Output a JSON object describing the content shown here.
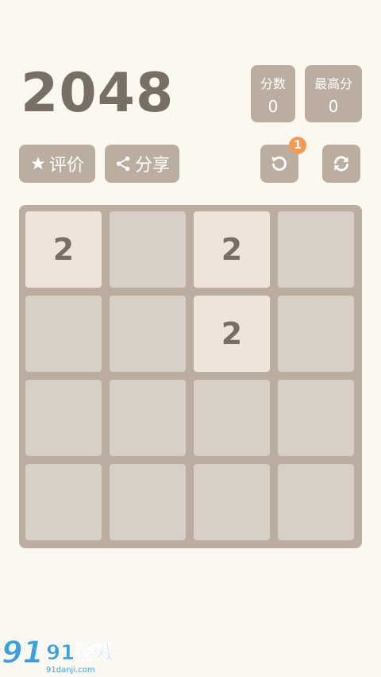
{
  "app": {
    "title": "2048"
  },
  "scores": {
    "current_label": "分数",
    "current_value": "0",
    "best_label": "最高分",
    "best_value": "0"
  },
  "toolbar": {
    "rate_label": "评价",
    "share_label": "分享",
    "undo_badge": "1"
  },
  "board": {
    "rows": [
      [
        "2",
        "",
        "2",
        ""
      ],
      [
        "",
        "",
        "2",
        ""
      ],
      [
        "",
        "",
        "",
        ""
      ],
      [
        "",
        "",
        "",
        ""
      ]
    ]
  },
  "watermark": {
    "text": "91游戏",
    "site": "91danji.com"
  },
  "colors": {
    "background": "#fbf8ef",
    "board": "#bbada0",
    "empty_cell": "#d8d0c6",
    "tile_2": "#eee4da",
    "text_dark": "#776e65",
    "badge": "#f49a52"
  }
}
